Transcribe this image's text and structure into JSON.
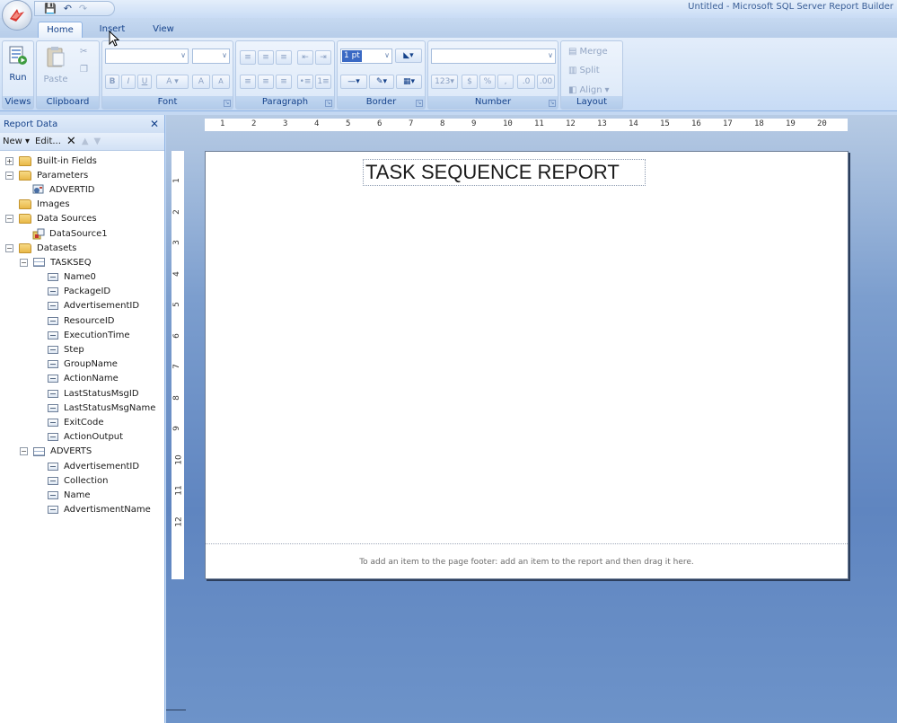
{
  "window": {
    "title": "Untitled - Microsoft SQL Server Report Builder"
  },
  "quick_access": {
    "save_icon": "save-icon",
    "undo_icon": "undo-icon",
    "redo_icon": "redo-icon"
  },
  "tabs": [
    {
      "label": "Home",
      "active": true
    },
    {
      "label": "Insert",
      "active": false
    },
    {
      "label": "View",
      "active": false
    }
  ],
  "ribbon": {
    "views": {
      "label": "Views",
      "run_label": "Run"
    },
    "clipboard": {
      "label": "Clipboard",
      "paste_label": "Paste"
    },
    "font": {
      "label": "Font",
      "bold": "B",
      "italic": "I",
      "underline": "U",
      "grow": "A",
      "shrink": "A"
    },
    "paragraph": {
      "label": "Paragraph"
    },
    "border": {
      "label": "Border",
      "border_width_value": "1 pt"
    },
    "number": {
      "label": "Number",
      "currency": "$",
      "percent": "%",
      "style": ","
    },
    "layout": {
      "label": "Layout",
      "merge_label": "Merge",
      "split_label": "Split",
      "align_label": "Align"
    }
  },
  "report_data": {
    "title": "Report Data",
    "toolbar": {
      "new_label": "New",
      "edit_label": "Edit..."
    },
    "tree": {
      "built_in_fields": "Built-in Fields",
      "parameters": "Parameters",
      "param_advertid": "ADVERTID",
      "images": "Images",
      "data_sources": "Data Sources",
      "datasource1": "DataSource1",
      "datasets": "Datasets",
      "taskseq": "TASKSEQ",
      "taskseq_fields": [
        "Name0",
        "PackageID",
        "AdvertisementID",
        "ResourceID",
        "ExecutionTime",
        "Step",
        "GroupName",
        "ActionName",
        "LastStatusMsgID",
        "LastStatusMsgName",
        "ExitCode",
        "ActionOutput"
      ],
      "adverts": "ADVERTS",
      "adverts_fields": [
        "AdvertisementID",
        "Collection",
        "Name",
        "AdvertismentName"
      ]
    }
  },
  "ruler": {
    "horizontal": [
      "1",
      "2",
      "3",
      "4",
      "5",
      "6",
      "7",
      "8",
      "9",
      "10",
      "11",
      "12",
      "13",
      "14",
      "15",
      "16",
      "17",
      "18",
      "19",
      "20"
    ],
    "vertical": [
      "1",
      "2",
      "3",
      "4",
      "5",
      "6",
      "7",
      "8",
      "9",
      "10",
      "11",
      "12"
    ]
  },
  "report": {
    "title_text": "TASK SEQUENCE REPORT",
    "footer_hint": "To add an item to the page footer: add an item to the report and then drag it here."
  }
}
